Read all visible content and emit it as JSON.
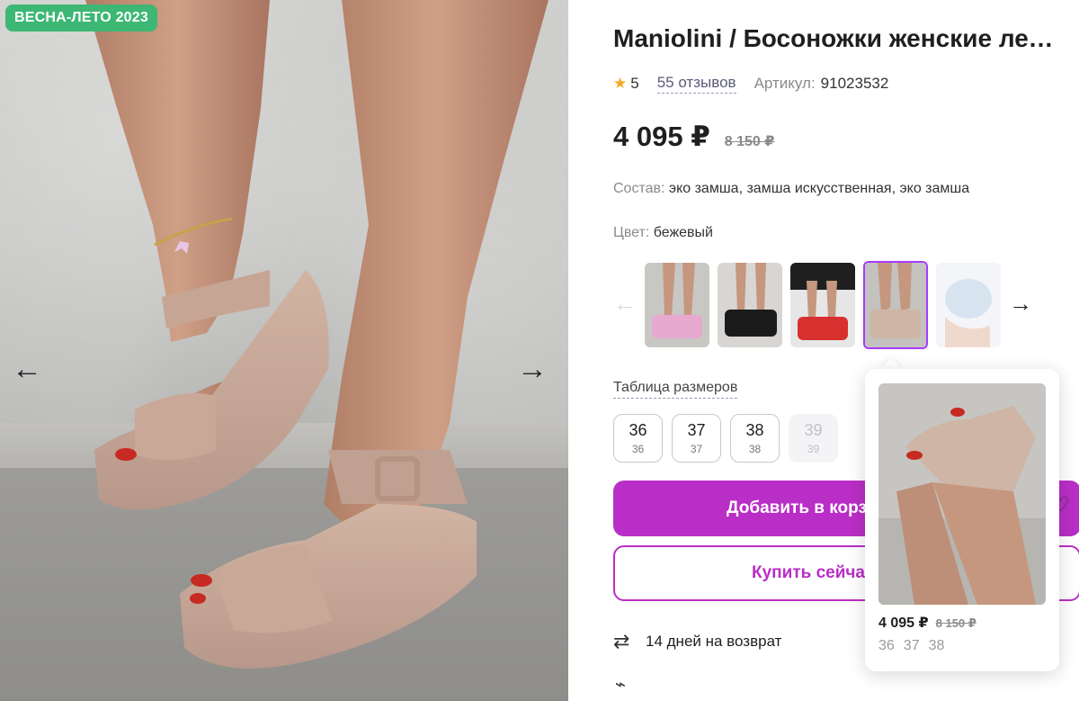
{
  "gallery": {
    "badge": "ВЕСНА-ЛЕТО 2023",
    "prev_icon": "arrow-left-icon",
    "next_icon": "arrow-right-icon"
  },
  "product": {
    "title": "Maniolini / Босоножки женские летние",
    "rating": "5",
    "reviews": "55 отзывов",
    "article_label": "Артикул:",
    "article_value": "91023532",
    "price": "4 095 ₽",
    "old_price": "8 150 ₽",
    "composition_label": "Состав:",
    "composition_value": "эко замша, замша искусственная, эко замша",
    "color_label": "Цвет:",
    "color_value": "бежевый"
  },
  "color_variants": [
    {
      "name": "розовый",
      "accent": "#e7a9cf"
    },
    {
      "name": "черный",
      "accent": "#1b1b1b"
    },
    {
      "name": "красный",
      "accent": "#d8302f"
    },
    {
      "name": "бежевый",
      "accent": "#cfb5a5",
      "selected": true
    },
    {
      "name": "голубой",
      "accent": "#d7e4ef"
    }
  ],
  "sizes": {
    "table_link": "Таблица размеров",
    "items": [
      {
        "eu": "36",
        "ru": "36",
        "available": true
      },
      {
        "eu": "37",
        "ru": "37",
        "available": true
      },
      {
        "eu": "38",
        "ru": "38",
        "available": true
      },
      {
        "eu": "39",
        "ru": "39",
        "available": false
      }
    ]
  },
  "actions": {
    "add_to_cart": "Добавить в корзину",
    "buy_now": "Купить сейчас"
  },
  "delivery": {
    "return_text": "14 дней на возврат"
  },
  "popup": {
    "price": "4 095 ₽",
    "old_price": "8 150 ₽",
    "sizes": [
      "36",
      "37",
      "38"
    ]
  },
  "colors": {
    "accent": "#b92ec6",
    "badge": "#3db774",
    "selected_border": "#a73afd"
  }
}
